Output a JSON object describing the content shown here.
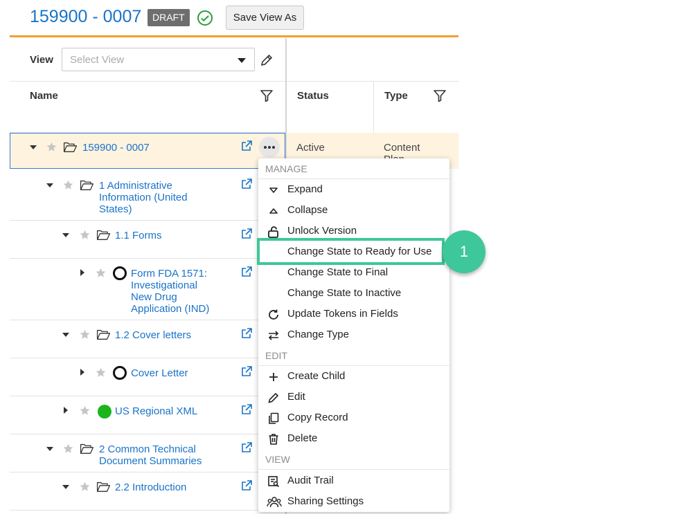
{
  "header": {
    "title": "159900 - 0007",
    "badge": "DRAFT",
    "status_icon": "check-circle-icon",
    "save_view_label": "Save View As",
    "accent_color": "#f0a030"
  },
  "view_bar": {
    "label": "View",
    "placeholder": "Select View"
  },
  "columns": {
    "name": "Name",
    "status": "Status",
    "type": "Type"
  },
  "tree": {
    "root": {
      "label": "159900 - 0007",
      "status": "Active",
      "type": "Content Plan"
    },
    "n1": "1 Administrative Information (United States)",
    "n11": "1.1 Forms",
    "n111": "Form FDA 1571: Investigational New Drug Application (IND)",
    "n12": "1.2 Cover letters",
    "n121": "Cover Letter",
    "n13": "US Regional XML",
    "n2": "2 Common Technical Document Summaries",
    "n22": "2.2 Introduction"
  },
  "menu": {
    "sections": {
      "manage": "MANAGE",
      "edit": "EDIT",
      "view": "VIEW"
    },
    "items": [
      {
        "label": "Expand",
        "icon": "expand-icon"
      },
      {
        "label": "Collapse",
        "icon": "collapse-icon"
      },
      {
        "label": "Unlock Version",
        "icon": "unlock-icon"
      },
      {
        "label": "Change State to Ready for Use",
        "icon": ""
      },
      {
        "label": "Change State to Final",
        "icon": ""
      },
      {
        "label": "Change State to Inactive",
        "icon": ""
      },
      {
        "label": "Update Tokens in Fields",
        "icon": "refresh-icon"
      },
      {
        "label": "Change Type",
        "icon": "swap-icon"
      },
      {
        "label": "Create Child",
        "icon": "plus-icon"
      },
      {
        "label": "Edit",
        "icon": "pencil-icon"
      },
      {
        "label": "Copy Record",
        "icon": "copy-icon"
      },
      {
        "label": "Delete",
        "icon": "trash-icon"
      },
      {
        "label": "Audit Trail",
        "icon": "audit-icon"
      },
      {
        "label": "Sharing Settings",
        "icon": "users-icon"
      }
    ]
  },
  "callout": {
    "step": "1",
    "color": "#3ec79a"
  }
}
